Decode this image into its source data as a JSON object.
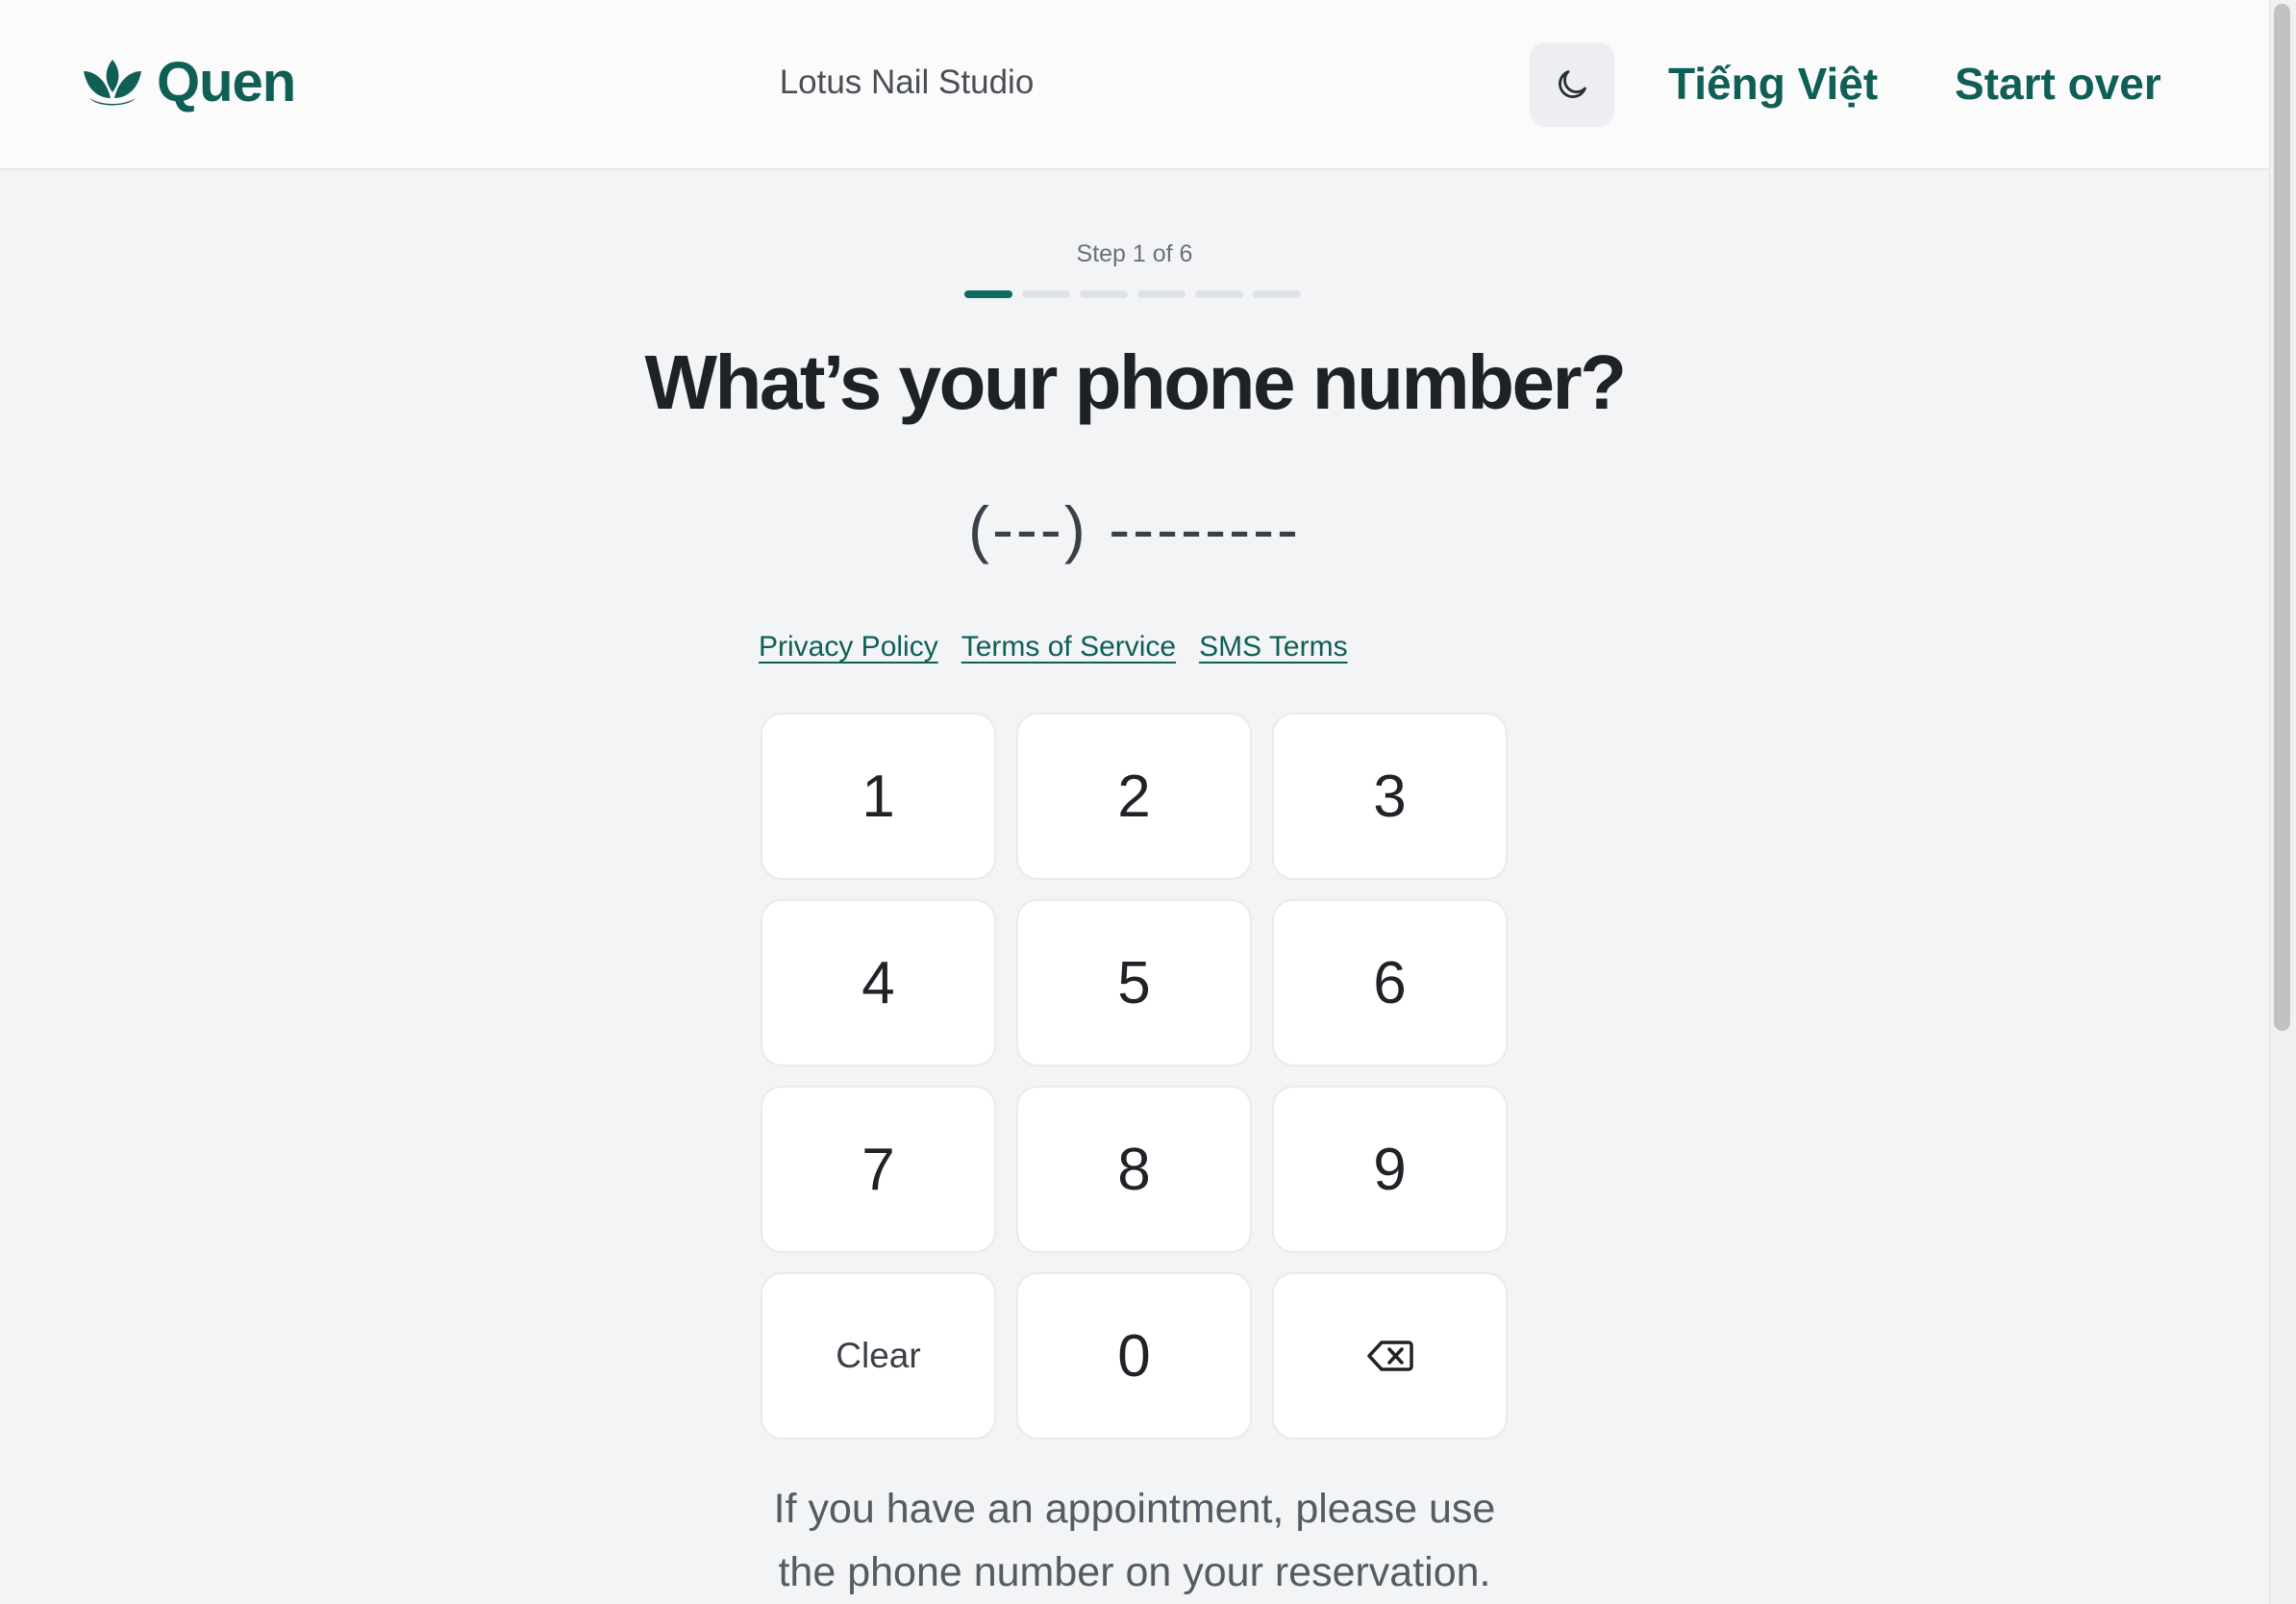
{
  "header": {
    "brand": "Quen",
    "studio": "Lotus Nail Studio",
    "language_label": "Tiếng Việt",
    "start_over_label": "Start over"
  },
  "progress": {
    "step_label": "Step 1 of 6",
    "current_step": 1,
    "total_steps": 6
  },
  "main": {
    "question": "What’s your phone number?",
    "phone_value": "(---) --------",
    "links": {
      "privacy": "Privacy Policy",
      "terms": "Terms of Service",
      "sms": "SMS Terms"
    },
    "keypad": {
      "k1": "1",
      "k2": "2",
      "k3": "3",
      "k4": "4",
      "k5": "5",
      "k6": "6",
      "k7": "7",
      "k8": "8",
      "k9": "9",
      "clear": "Clear",
      "k0": "0"
    },
    "hint_line1": "If you have an appointment, please use",
    "hint_line2": "the phone number on your reservation."
  },
  "colors": {
    "accent": "#0f5f56",
    "background": "#f3f4f6",
    "key_background": "#ffffff"
  },
  "icons": {
    "logo": "lotus-icon",
    "theme": "moon-icon",
    "backspace": "backspace-icon"
  }
}
